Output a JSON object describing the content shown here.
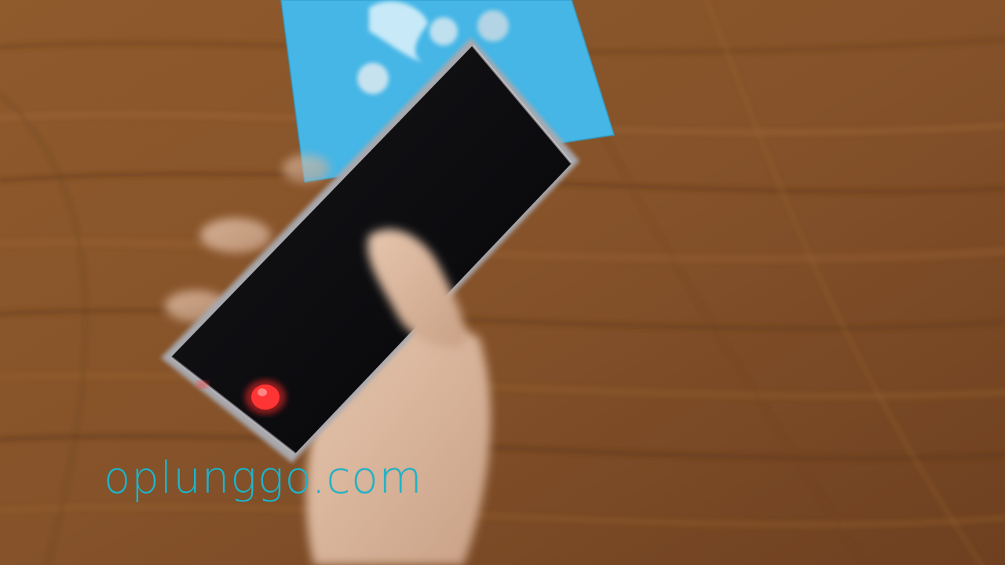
{
  "scene": {
    "description_icon": "hand-holding-phone-icon",
    "colors": {
      "table_wood": "#8a5428",
      "blue_card": "#45b6e6",
      "phone_body": "#0a0a0c",
      "phone_frame": "#a8a8ac",
      "notification_led": "#ff2a2a"
    }
  },
  "watermark": {
    "text": "oplunggo.com",
    "color": "#1fb3c8"
  }
}
